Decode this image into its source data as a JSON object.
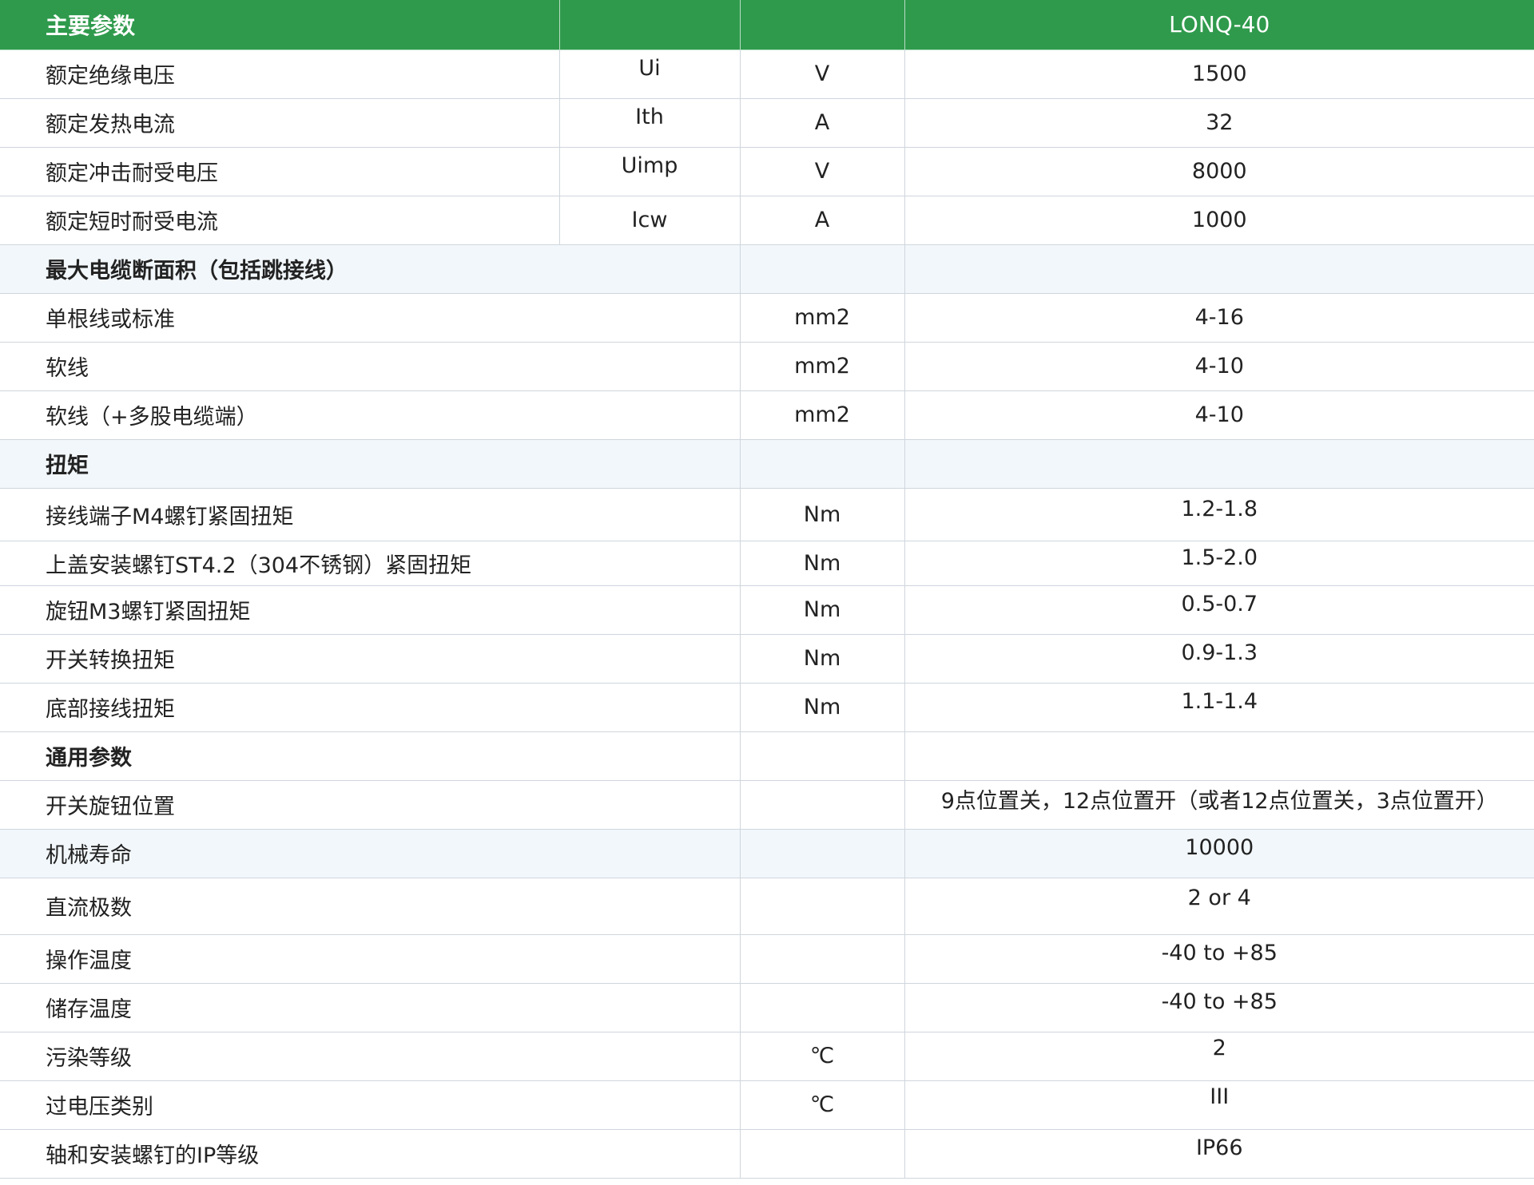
{
  "header": {
    "param": "主要参数",
    "model": "LONQ-40"
  },
  "electrical_rows": [
    {
      "name": "额定绝缘电压",
      "symbol": "Ui",
      "unit": "V",
      "value": "1500"
    },
    {
      "name": "额定发热电流",
      "symbol": "Ith",
      "unit": "A",
      "value": "32"
    },
    {
      "name": "额定冲击耐受电压",
      "symbol": "Uimp",
      "unit": "V",
      "value": "8000"
    },
    {
      "name": "额定短时耐受电流",
      "symbol": "Icw",
      "unit": "A",
      "value": "1000"
    }
  ],
  "cable_section": {
    "title": "最大电缆断面积（包括跳接线）",
    "rows": [
      {
        "name": "单根线或标准",
        "unit": "mm2",
        "value": "4-16"
      },
      {
        "name": "软线",
        "unit": "mm2",
        "value": "4-10"
      },
      {
        "name": "软线（+多股电缆端）",
        "unit": "mm2",
        "value": "4-10"
      }
    ]
  },
  "torque_section": {
    "title": "扭矩",
    "rows": [
      {
        "name": "接线端子M4螺钉紧固扭矩",
        "unit": "Nm",
        "value": "1.2-1.8"
      },
      {
        "name": "上盖安装螺钉ST4.2（304不锈钢）紧固扭矩",
        "unit": "Nm",
        "value": "1.5-2.0"
      },
      {
        "name": "旋钮M3螺钉紧固扭矩",
        "unit": "Nm",
        "value": "0.5-0.7"
      },
      {
        "name": "开关转换扭矩",
        "unit": "Nm",
        "value": "0.9-1.3"
      },
      {
        "name": "底部接线扭矩",
        "unit": "Nm",
        "value": "1.1-1.4"
      }
    ]
  },
  "general_section": {
    "title": "通用参数",
    "rows": [
      {
        "name": "开关旋钮位置",
        "unit": "",
        "value": "9点位置关，12点位置开（或者12点位置关，3点位置开）"
      },
      {
        "name": "机械寿命",
        "unit": "",
        "value": "10000"
      },
      {
        "name": "直流极数",
        "unit": "",
        "value": "2 or 4"
      },
      {
        "name": "操作温度",
        "unit": "",
        "value": "-40 to +85"
      },
      {
        "name": "储存温度",
        "unit": "",
        "value": "-40 to +85"
      },
      {
        "name": "污染等级",
        "unit": "℃",
        "value": "2"
      },
      {
        "name": "过电压类别",
        "unit": "℃",
        "value": "III"
      },
      {
        "name": "轴和安装螺钉的IP等级",
        "unit": "",
        "value": "IP66"
      }
    ]
  },
  "colors": {
    "header_bg": "#2f9a4c",
    "header_text": "#ffffff",
    "section_bg": "#f2f7fb",
    "grid_line": "#cfd6dd",
    "text": "#222222"
  }
}
